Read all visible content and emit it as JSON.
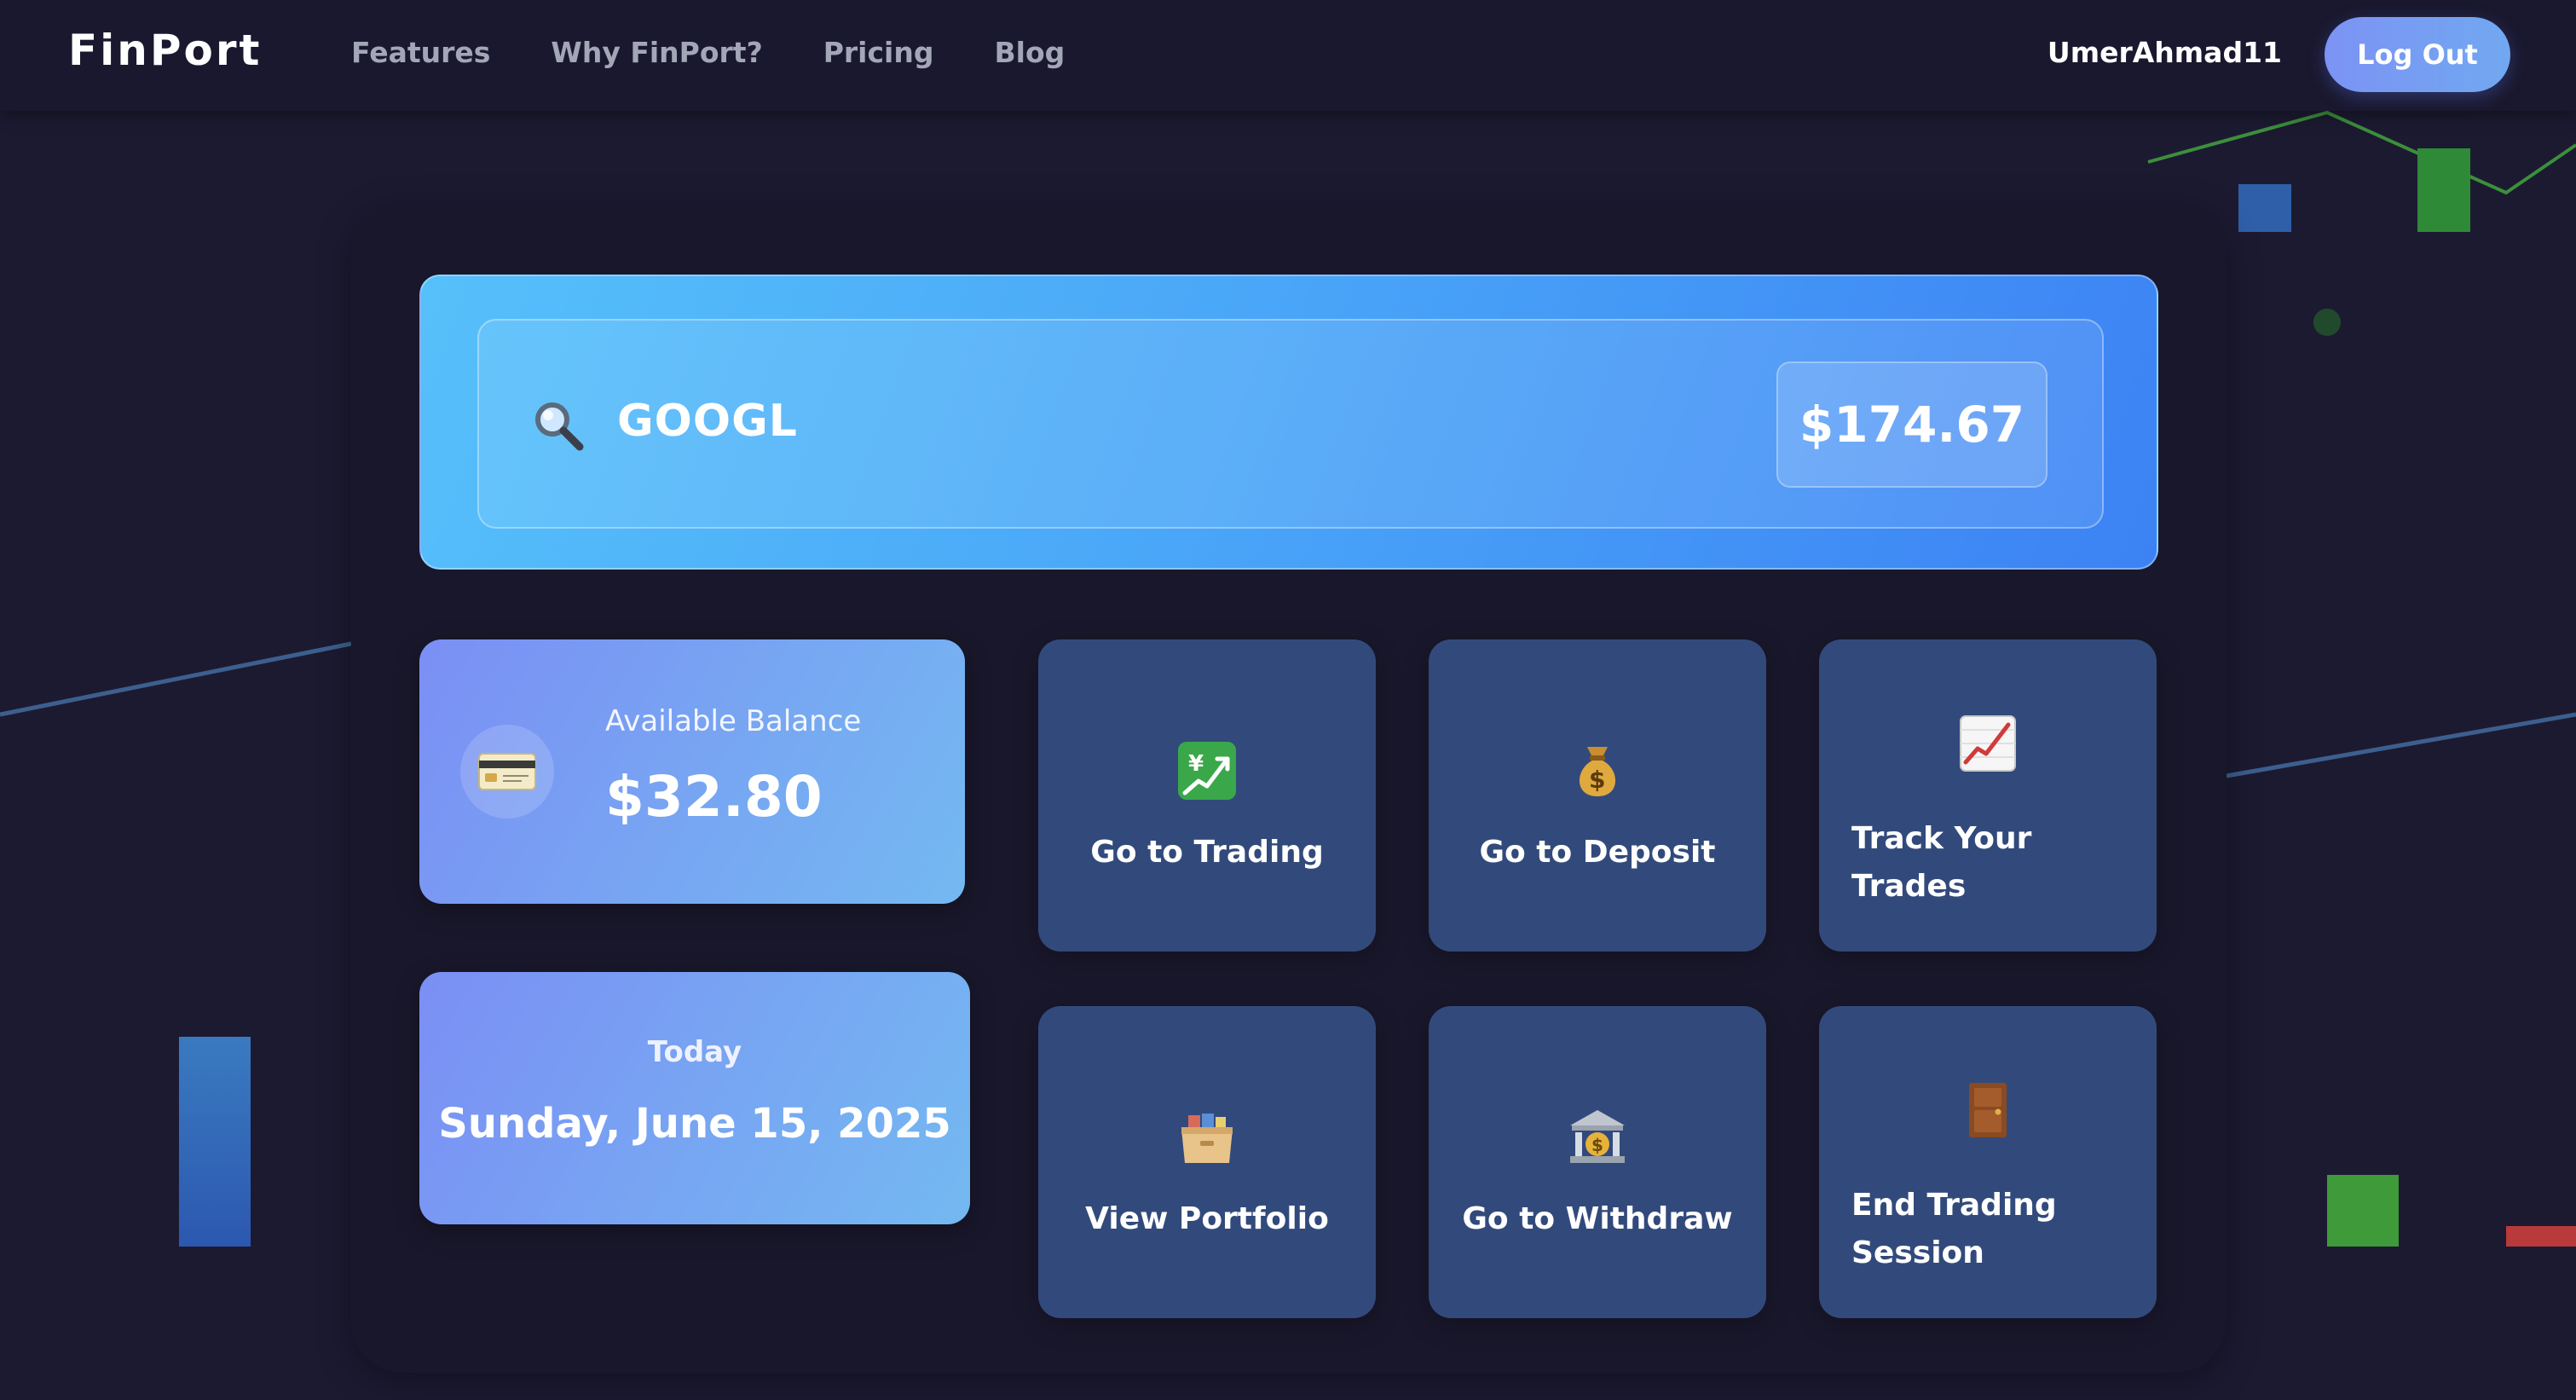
{
  "navbar": {
    "brand": "FinPort",
    "links": [
      "Features",
      "Why FinPort?",
      "Pricing",
      "Blog"
    ],
    "username": "UmerAhmad11",
    "logout_label": "Log Out"
  },
  "search": {
    "ticker": "GOOGL",
    "price": "$174.67"
  },
  "balance": {
    "label": "Available Balance",
    "value": "$32.80"
  },
  "date": {
    "label": "Today",
    "value": "Sunday, June 15, 2025"
  },
  "actions": [
    {
      "label": "Go to Trading",
      "icon": "chart-yen-icon"
    },
    {
      "label": "Go to Deposit",
      "icon": "money-bag-icon"
    },
    {
      "label": "Track Your Trades",
      "icon": "trend-chart-icon"
    },
    {
      "label": "View Portfolio",
      "icon": "card-file-box-icon"
    },
    {
      "label": "Go to Withdraw",
      "icon": "bank-icon"
    },
    {
      "label": "End Trading Session",
      "icon": "door-icon"
    }
  ],
  "colors": {
    "background": "#1c1a31",
    "panel": "#19172b",
    "tile": "#324a7b",
    "accent_gradient_start": "#56c0fa",
    "accent_gradient_end": "#3c82f4",
    "card_gradient_start": "#7b8ff4",
    "card_gradient_end": "#74b9f1"
  }
}
